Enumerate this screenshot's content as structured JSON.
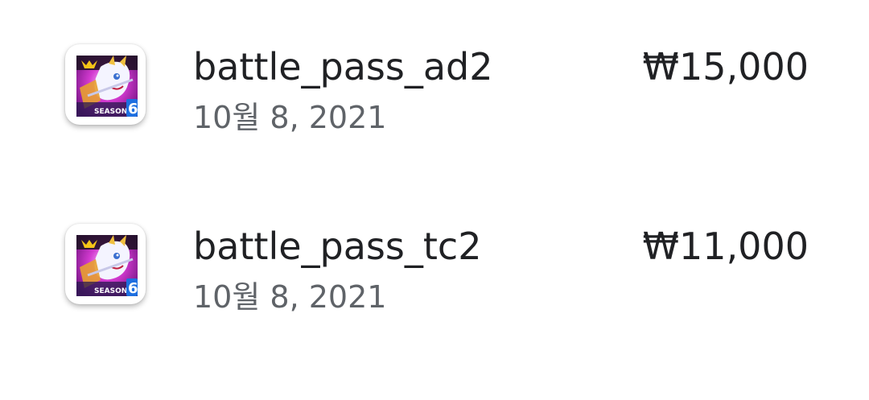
{
  "colors": {
    "title": "#202124",
    "secondary": "#5f6368",
    "background": "#ffffff"
  },
  "purchases": [
    {
      "icon": "game-app-icon",
      "icon_badge": "SEASON 6",
      "name": "battle_pass_ad2",
      "date": "10월 8, 2021",
      "price": "₩15,000"
    },
    {
      "icon": "game-app-icon",
      "icon_badge": "SEASON 6",
      "name": "battle_pass_tc2",
      "date": "10월 8, 2021",
      "price": "₩11,000"
    }
  ]
}
